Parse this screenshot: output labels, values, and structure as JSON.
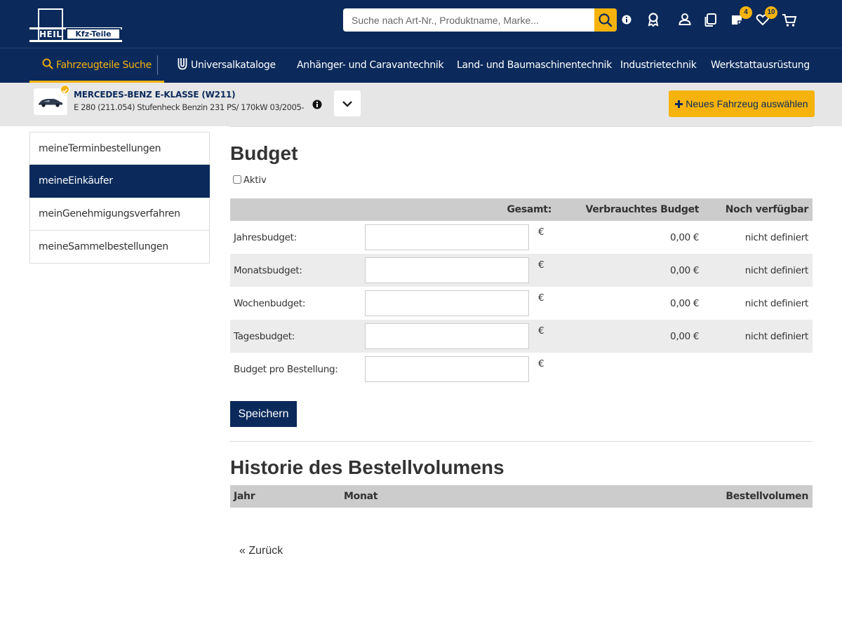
{
  "header": {
    "logo_primary": "HEIL",
    "logo_secondary": "Kfz-Teile",
    "search_placeholder": "Suche nach Art-Nr., Produktname, Marke...",
    "notepad_badge": "4",
    "wishlist_badge": "10",
    "icons": [
      "search-icon",
      "info-icon",
      "award-icon",
      "user-icon",
      "compare-icon",
      "notepad-icon",
      "heart-icon",
      "cart-icon"
    ]
  },
  "nav": {
    "items": [
      "Fahrzeugteile Suche",
      "Universalkataloge",
      "Anhänger- und Caravantechnik",
      "Land- und Baumaschinentechnik",
      "Industrietechnik",
      "Werkstattausrüstung"
    ]
  },
  "vehicle": {
    "title": "MERCEDES-BENZ E-KLASSE (W211)",
    "subtitle": "E 280 (211.054) Stufenheck Benzin 231 PS/ 170kW 03/2005-",
    "new_vehicle_label": "Neues Fahrzeug auswählen"
  },
  "sidebar": {
    "items": [
      "meineTerminbestellungen",
      "meineEinkäufer",
      "meinGenehmigungsverfahren",
      "meineSammelbestellungen"
    ]
  },
  "budget": {
    "title": "Budget",
    "active_label": "Aktiv",
    "headers": [
      "Gesamt:",
      "Verbrauchtes Budget",
      "Noch verfügbar"
    ],
    "currency": "€",
    "rows": [
      {
        "label": "Jahresbudget:",
        "value": "",
        "used": "0,00 €",
        "available": "nicht definiert"
      },
      {
        "label": "Monatsbudget:",
        "value": "",
        "used": "0,00 €",
        "available": "nicht definiert"
      },
      {
        "label": "Wochenbudget:",
        "value": "",
        "used": "0,00 €",
        "available": "nicht definiert"
      },
      {
        "label": "Tagesbudget:",
        "value": "",
        "used": "0,00 €",
        "available": "nicht definiert"
      },
      {
        "label": "Budget pro Bestellung:",
        "value": "",
        "used": "",
        "available": ""
      }
    ],
    "save_label": "Speichern"
  },
  "history": {
    "title": "Historie des Bestellvolumens",
    "headers": [
      "Jahr",
      "Monat",
      "Bestellvolumen"
    ]
  },
  "back_label": "« Zurück",
  "colors": {
    "navy": "#0b2a5b",
    "accent": "#f6b30e",
    "row_alt": "#ececec",
    "header_gray": "#cccccc"
  }
}
